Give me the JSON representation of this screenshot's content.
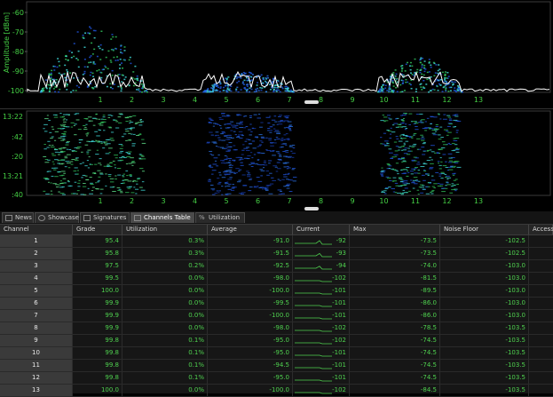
{
  "amplitude_chart": {
    "ylabel": "Amplitude [dBm]",
    "y_ticks": [
      "-60",
      "-70",
      "-80",
      "-90",
      "-100"
    ],
    "x_ticks": [
      "1",
      "2",
      "3",
      "4",
      "5",
      "6",
      "7",
      "8",
      "9",
      "10",
      "11",
      "12",
      "13"
    ]
  },
  "waterfall_chart": {
    "y_ticks": [
      "13:22",
      ":42",
      ":20",
      "13:21",
      ":40"
    ],
    "x_ticks": [
      "1",
      "2",
      "3",
      "4",
      "5",
      "6",
      "7",
      "8",
      "9",
      "10",
      "11",
      "12",
      "13"
    ]
  },
  "tabs": [
    {
      "label": "News",
      "icon": "news-icon"
    },
    {
      "label": "Showcase",
      "icon": "showcase-icon"
    },
    {
      "label": "Signatures",
      "icon": "signatures-icon"
    },
    {
      "label": "Channels Table",
      "icon": "table-icon"
    },
    {
      "label": "Utilization",
      "icon": "percent-icon"
    }
  ],
  "active_tab": "Channels Table",
  "table": {
    "columns": [
      "Channel",
      "Grade",
      "Utilization",
      "Average",
      "Current",
      "Max",
      "Noise Floor",
      "Access"
    ],
    "rows": [
      {
        "channel": "1",
        "grade": "95.4",
        "utilization": "0.3%",
        "average": "-91.0",
        "current": "-92",
        "max": "-73.5",
        "noise_floor": "-102.5"
      },
      {
        "channel": "2",
        "grade": "95.8",
        "utilization": "0.3%",
        "average": "-91.5",
        "current": "-93",
        "max": "-73.5",
        "noise_floor": "-102.5"
      },
      {
        "channel": "3",
        "grade": "97.5",
        "utilization": "0.2%",
        "average": "-92.5",
        "current": "-94",
        "max": "-74.0",
        "noise_floor": "-103.0"
      },
      {
        "channel": "4",
        "grade": "99.5",
        "utilization": "0.0%",
        "average": "-98.0",
        "current": "-102",
        "max": "-81.5",
        "noise_floor": "-103.0"
      },
      {
        "channel": "5",
        "grade": "100.0",
        "utilization": "0.0%",
        "average": "-100.0",
        "current": "-101",
        "max": "-89.5",
        "noise_floor": "-103.0"
      },
      {
        "channel": "6",
        "grade": "99.9",
        "utilization": "0.0%",
        "average": "-99.5",
        "current": "-101",
        "max": "-86.0",
        "noise_floor": "-103.0"
      },
      {
        "channel": "7",
        "grade": "99.9",
        "utilization": "0.0%",
        "average": "-100.0",
        "current": "-101",
        "max": "-86.0",
        "noise_floor": "-103.0"
      },
      {
        "channel": "8",
        "grade": "99.9",
        "utilization": "0.0%",
        "average": "-98.0",
        "current": "-102",
        "max": "-78.5",
        "noise_floor": "-103.5"
      },
      {
        "channel": "9",
        "grade": "99.8",
        "utilization": "0.1%",
        "average": "-95.0",
        "current": "-102",
        "max": "-74.5",
        "noise_floor": "-103.5"
      },
      {
        "channel": "10",
        "grade": "99.8",
        "utilization": "0.1%",
        "average": "-95.0",
        "current": "-101",
        "max": "-74.5",
        "noise_floor": "-103.5"
      },
      {
        "channel": "11",
        "grade": "99.8",
        "utilization": "0.1%",
        "average": "-94.5",
        "current": "-101",
        "max": "-74.5",
        "noise_floor": "-103.5"
      },
      {
        "channel": "12",
        "grade": "99.8",
        "utilization": "0.1%",
        "average": "-95.0",
        "current": "-101",
        "max": "-74.5",
        "noise_floor": "-103.5"
      },
      {
        "channel": "13",
        "grade": "100.0",
        "utilization": "0.0%",
        "average": "-100.0",
        "current": "-102",
        "max": "-84.5",
        "noise_floor": "-103.5"
      }
    ]
  },
  "colors": {
    "accent_green": "#4fd14f",
    "spectrum_cyan": "#3fd6d6",
    "spectrum_blue": "#1f52d8",
    "trace_white": "#ffffff",
    "trace_yellow": "#f0f040"
  }
}
